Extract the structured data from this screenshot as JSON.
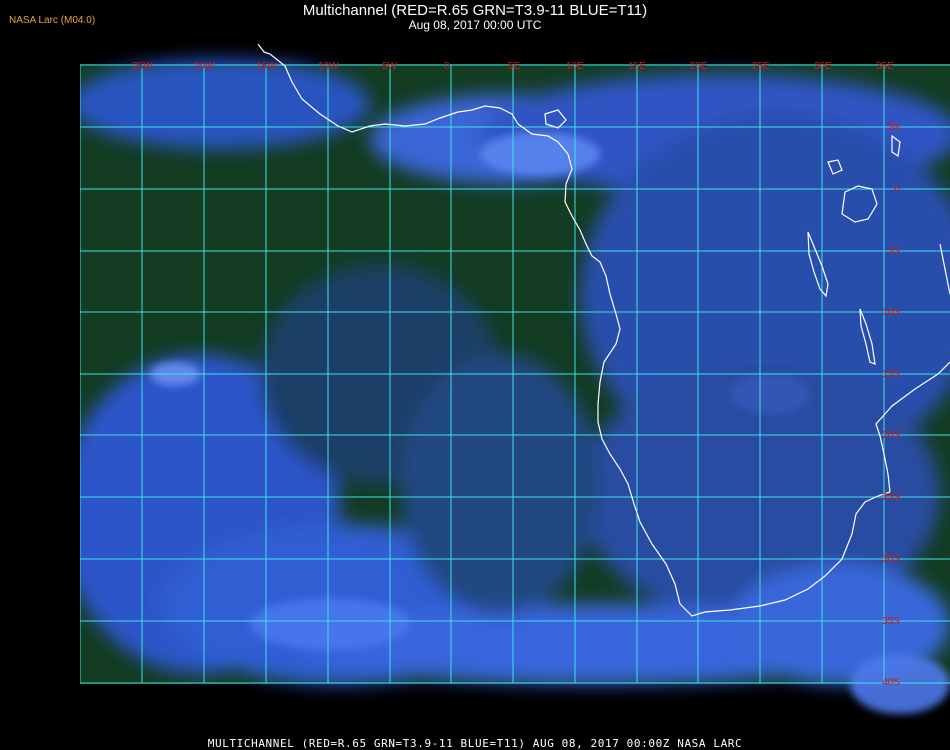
{
  "header": {
    "title": "Multichannel (RED=R.65 GRN=T3.9-11 BLUE=T11)",
    "subtitle": "Aug 08, 2017 00:00 UTC",
    "brand": "NASA Larc (M04.0)"
  },
  "map": {
    "lon_labels": [
      "25W",
      "20W",
      "15W",
      "10W",
      "5W",
      "0",
      "5E",
      "10E",
      "15E",
      "20E",
      "25E",
      "30E",
      "35E"
    ],
    "lat_labels": [
      "5N",
      "0",
      "5S",
      "10S",
      "15S",
      "20S",
      "25S",
      "30S",
      "35S",
      "40S"
    ],
    "lat_top_label": "35E",
    "colors": {
      "grid": "#3ee0e6",
      "label": "#d21818",
      "coast": "#ffffff",
      "ocean_green": "#123d1c",
      "cloud_blue": "#2f5bd8",
      "land_blue": "#284a9e"
    }
  },
  "footer": {
    "text": "MULTICHANNEL (RED=R.65 GRN=T3.9-11 BLUE=T11) AUG 08, 2017 00:00Z  NASA LARC"
  }
}
